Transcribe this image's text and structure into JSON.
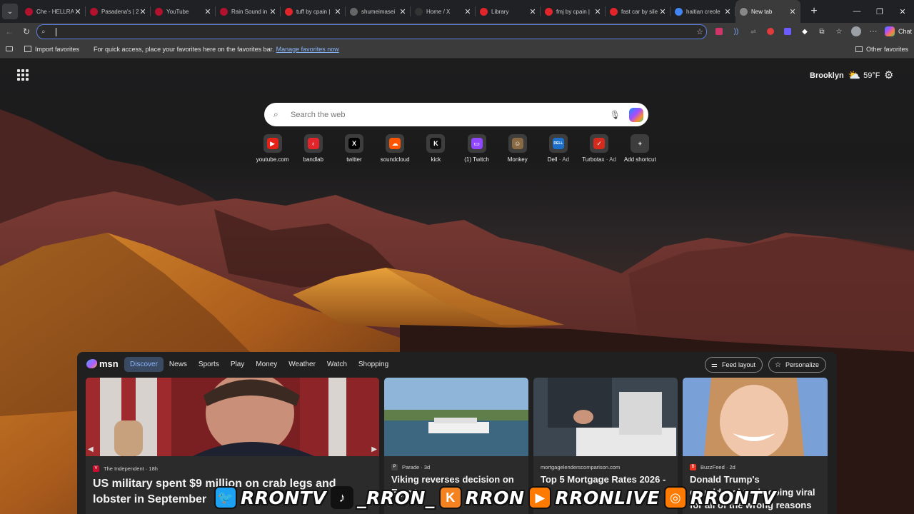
{
  "tabs": [
    {
      "title": "Che - HELLRAI",
      "favicon": "youtube-icon",
      "color": "#b3122f"
    },
    {
      "title": "Pasadena's | 2x",
      "favicon": "youtube-icon",
      "color": "#b3122f"
    },
    {
      "title": "YouTube",
      "favicon": "youtube-icon",
      "color": "#b3122f"
    },
    {
      "title": "Rain Sound in",
      "favicon": "youtube-icon",
      "color": "#b3122f"
    },
    {
      "title": "tuff by cpain |",
      "favicon": "bandlab-icon",
      "color": "#e2252b"
    },
    {
      "title": "shumeimasei",
      "favicon": "globe-icon",
      "color": "#666666"
    },
    {
      "title": "Home / X",
      "favicon": "x-icon",
      "color": "#333333"
    },
    {
      "title": "Library",
      "favicon": "bandlab-icon",
      "color": "#e2252b"
    },
    {
      "title": "fmj by cpain |",
      "favicon": "bandlab-icon",
      "color": "#e2252b"
    },
    {
      "title": "fast car by sile",
      "favicon": "bandlab-icon",
      "color": "#e2252b"
    },
    {
      "title": "haitian creole",
      "favicon": "google-icon",
      "color": "#4285f4"
    },
    {
      "title": "New tab",
      "favicon": "newtab-icon",
      "color": "#888888",
      "active": true
    }
  ],
  "address_bar": {
    "value": "",
    "placeholder": ""
  },
  "favorites_bar": {
    "import_label": "Import favorites",
    "hint": "For quick access, place your favorites here on the favorites bar.",
    "manage_link": "Manage favorites now",
    "other_label": "Other favorites"
  },
  "toolbar": {
    "chat_label": "Chat"
  },
  "weather": {
    "location": "Brooklyn",
    "temp": "59°F",
    "condition_icon": "partly-cloudy-icon"
  },
  "search": {
    "placeholder": "Search the web"
  },
  "shortcuts": [
    {
      "label": "youtube.com",
      "ad": "",
      "icon": "youtube-icon",
      "color": "#e62117",
      "glyph": "▶"
    },
    {
      "label": "bandlab",
      "ad": "",
      "icon": "bandlab-icon",
      "color": "#e2252b",
      "glyph": "♁"
    },
    {
      "label": "twitter",
      "ad": "",
      "icon": "x-icon",
      "color": "#000000",
      "glyph": "X"
    },
    {
      "label": "soundcloud",
      "ad": "",
      "icon": "soundcloud-icon",
      "color": "#ff5500",
      "glyph": "☁"
    },
    {
      "label": "kick",
      "ad": "",
      "icon": "kick-icon",
      "color": "#111111",
      "glyph": "K"
    },
    {
      "label": "(1) Twitch",
      "ad": "",
      "icon": "twitch-icon",
      "color": "#9146ff",
      "glyph": "▭"
    },
    {
      "label": "Monkey",
      "ad": "",
      "icon": "monkey-icon",
      "color": "#8a6a42",
      "glyph": "☺"
    },
    {
      "label": "Dell",
      "ad": "· Ad",
      "icon": "dell-icon",
      "color": "#1b6fc9",
      "glyph": "DELL"
    },
    {
      "label": "Turbotax",
      "ad": "· Ad",
      "icon": "turbotax-icon",
      "color": "#d52b1e",
      "glyph": "✓"
    },
    {
      "label": "Add shortcut",
      "ad": "",
      "icon": "plus-icon",
      "color": "transparent",
      "glyph": "+"
    }
  ],
  "feed": {
    "brand": "msn",
    "nav": [
      "Discover",
      "News",
      "Sports",
      "Play",
      "Money",
      "Weather",
      "Watch",
      "Shopping"
    ],
    "active_nav": "Discover",
    "feed_layout_label": "Feed layout",
    "personalize_label": "Personalize",
    "cards": [
      {
        "source": "The Independent",
        "age": "· 18h",
        "title": "US military spent $9 million on crab legs and lobster in September",
        "source_color": "#c8102e"
      },
      {
        "source": "Parade",
        "age": "· 3d",
        "title": "Viking reverses decision on Egypt",
        "source_color": "#444444"
      },
      {
        "source": "mortgagelenderscomparison.com",
        "age": "",
        "title": "Top 5 Mortgage Rates 2026 -",
        "source_color": ""
      },
      {
        "source": "BuzzFeed",
        "age": "· 2d",
        "title": "Donald Trump's granddaughter is going viral for all of the wrong reasons",
        "source_color": "#ee3322"
      }
    ]
  },
  "overlay": [
    {
      "icon": "twitter-bird-icon",
      "handle": "RRONTV",
      "color": "#1da1f2"
    },
    {
      "icon": "tiktok-icon",
      "handle": "_RRON_",
      "color": "#111111"
    },
    {
      "icon": "kick-icon",
      "handle": "RRON",
      "color": "#f58220"
    },
    {
      "icon": "youtube-icon",
      "handle": "RRONLIVE",
      "color": "#ff7a00"
    },
    {
      "icon": "instagram-icon",
      "handle": "RRONTV",
      "color": "#ff7a00"
    }
  ]
}
